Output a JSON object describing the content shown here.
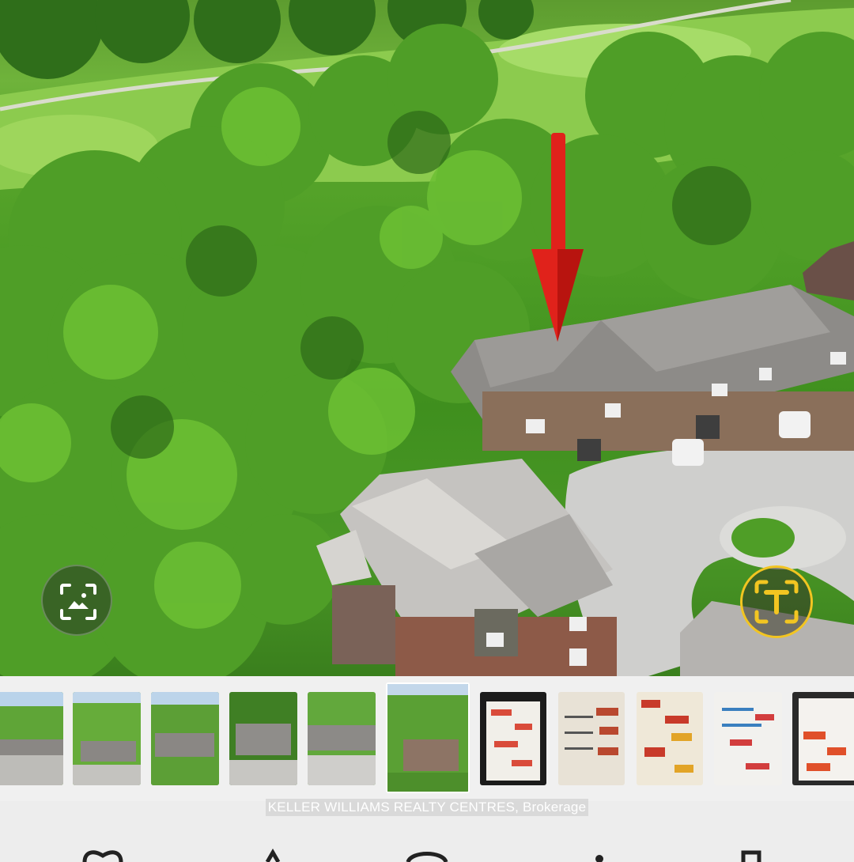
{
  "photo": {
    "description_icon": "aerial-house-photo",
    "arrow_color": "#e0221b"
  },
  "lens_button": {
    "icon": "image-scan-icon"
  },
  "text_button": {
    "icon": "text-select-icon",
    "accent": "#f2c521"
  },
  "thumbnails": {
    "selected_index": 5,
    "items": [
      {
        "kind": "aerial"
      },
      {
        "kind": "aerial"
      },
      {
        "kind": "aerial"
      },
      {
        "kind": "aerial"
      },
      {
        "kind": "aerial"
      },
      {
        "kind": "aerial"
      },
      {
        "kind": "candy-poster"
      },
      {
        "kind": "candy-poster"
      },
      {
        "kind": "candy-poster"
      },
      {
        "kind": "candy-poster"
      },
      {
        "kind": "candy-poster"
      }
    ]
  },
  "caption": {
    "text": "KELLER WILLIAMS REALTY CENTRES, Brokerage"
  },
  "toolbar": {
    "icons": [
      "heart-icon",
      "share-icon",
      "search-icon",
      "edit-icon",
      "trash-icon"
    ]
  }
}
